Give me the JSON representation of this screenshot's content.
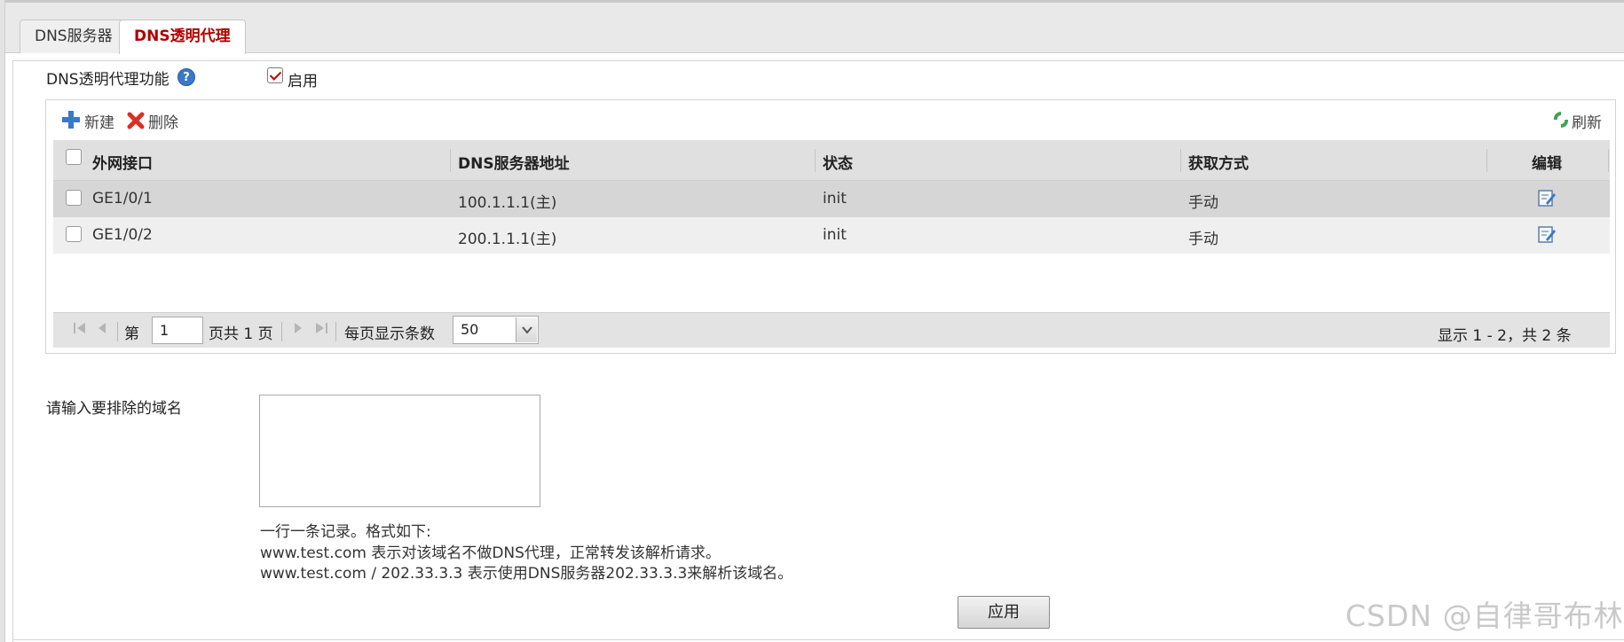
{
  "tabs": [
    {
      "label": "DNS服务器",
      "active": false
    },
    {
      "label": "DNS透明代理",
      "active": true
    }
  ],
  "proxy": {
    "feature_label": "DNS透明代理功能",
    "help_glyph": "?",
    "enable_label": "启用",
    "enabled": true
  },
  "toolbar": {
    "new_label": "新建",
    "delete_label": "删除",
    "refresh_label": "刷新"
  },
  "table": {
    "columns": [
      "外网接口",
      "DNS服务器地址",
      "状态",
      "获取方式",
      "编辑"
    ],
    "rows": [
      {
        "interface": "GE1/0/1",
        "dns": "100.1.1.1(主)",
        "status": "init",
        "method": "手动"
      },
      {
        "interface": "GE1/0/2",
        "dns": "200.1.1.1(主)",
        "status": "init",
        "method": "手动"
      }
    ]
  },
  "pager": {
    "page_prefix": "第",
    "page_value": "1",
    "page_suffix": "页共 1 页",
    "per_page_label": "每页显示条数",
    "per_page_value": "50",
    "summary": "显示 1 - 2，共 2 条"
  },
  "exclude": {
    "label": "请输入要排除的域名",
    "textarea_value": "",
    "help_line1": "一行一条记录。格式如下:",
    "help_line2": "www.test.com 表示对该域名不做DNS代理，正常转发该解析请求。",
    "help_line3": "www.test.com / 202.33.3.3 表示使用DNS服务器202.33.3.3来解析该域名。"
  },
  "apply_label": "应用",
  "watermark": "CSDN @自律哥布林",
  "colors": {
    "active_tab_text": "#b00000",
    "checkmark": "#c00000",
    "add_icon": "#3a78c9",
    "delete_icon": "#d93025",
    "refresh_icon": "#3aa655"
  },
  "icons": [
    "help-icon",
    "add-icon",
    "delete-icon",
    "refresh-icon",
    "edit-icon",
    "first-page-icon",
    "prev-page-icon",
    "next-page-icon",
    "last-page-icon",
    "dropdown-arrow-icon"
  ]
}
